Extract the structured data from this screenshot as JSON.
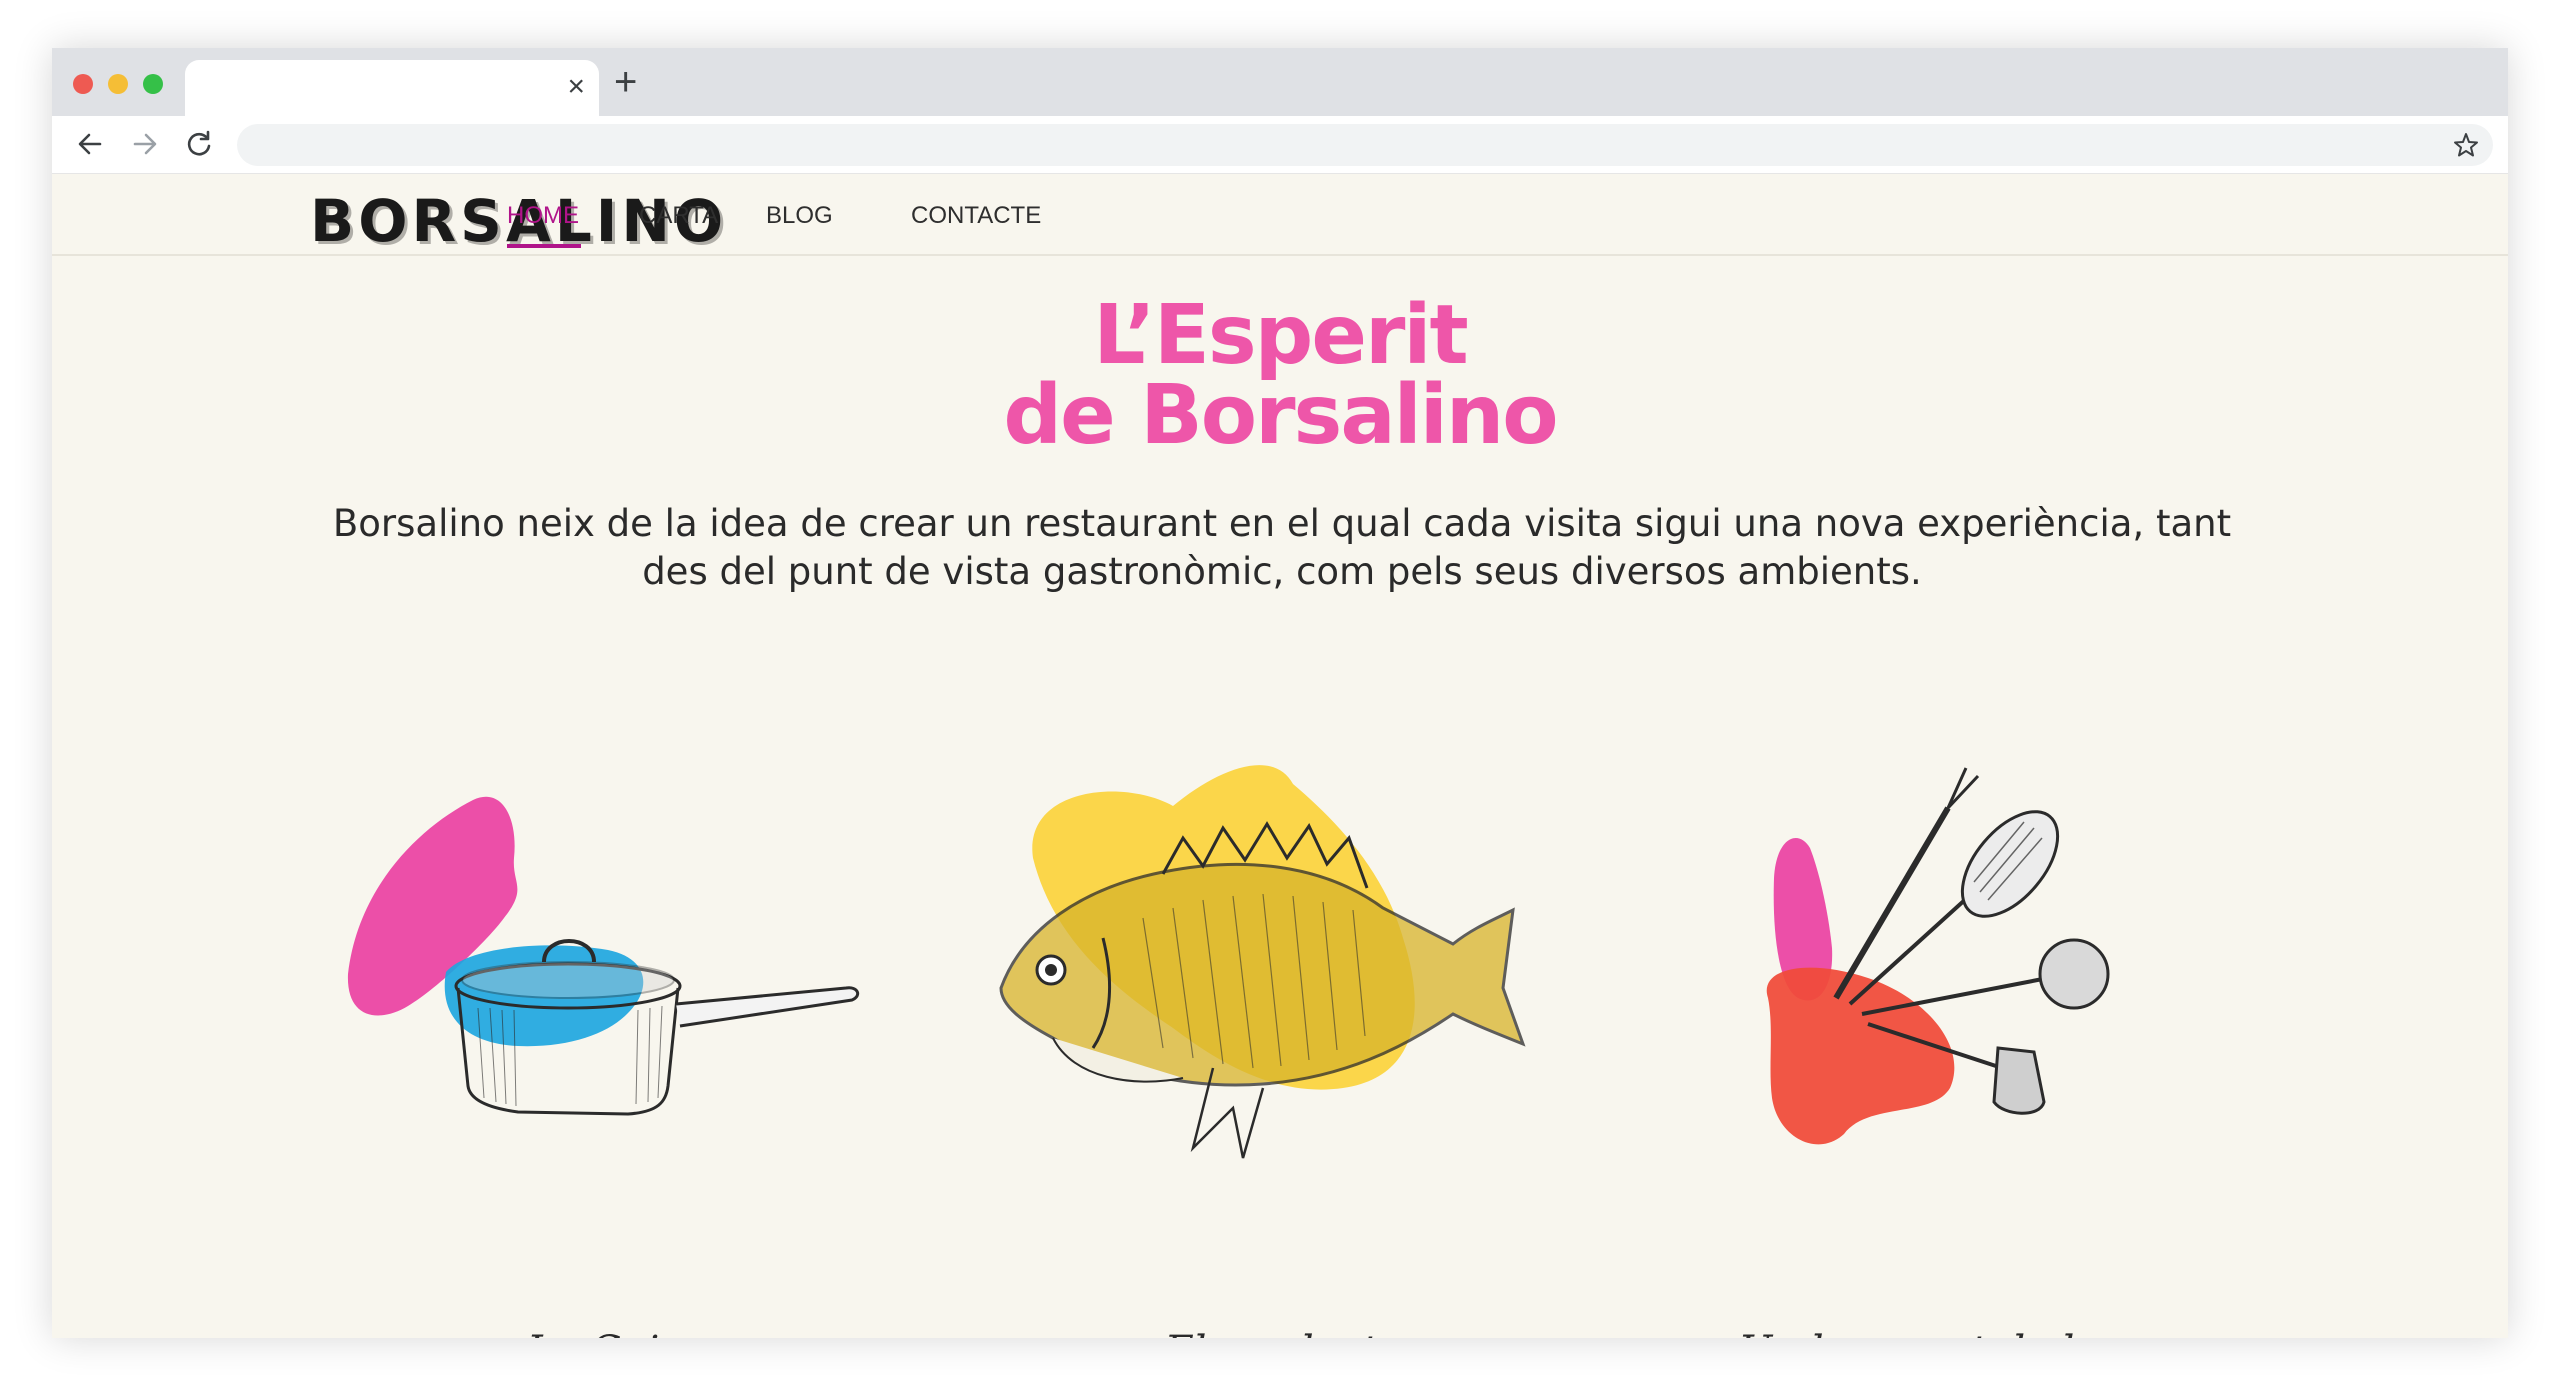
{
  "browser": {
    "tab_close_glyph": "×",
    "new_tab_glyph": "+",
    "icons": [
      "back-arrow-icon",
      "forward-arrow-icon",
      "reload-icon",
      "bookmark-star-icon"
    ]
  },
  "site": {
    "logo": "BORSALINO",
    "nav": [
      "HOME",
      "CARTA",
      "BLOG",
      "CONTACTE"
    ],
    "active_nav": "HOME",
    "accent": "#b0148a"
  },
  "hero": {
    "title_line1": "L’Esperit",
    "title_line2": "de Borsalino",
    "subtitle": "Borsalino neix de la idea de crear un restaurant en el qual cada visita sigui una nova experiència, tant des del punt de vista gastronòmic, com pels seus diversos ambients.",
    "title_color": "#ee56a9"
  },
  "features": [
    {
      "label": "La Cuina",
      "illustration": "cooking-pot-illustration",
      "colors": [
        "#ec4fa8",
        "#1ea6e0"
      ]
    },
    {
      "label": "El producte",
      "illustration": "fish-illustration",
      "colors": [
        "#fbd64a"
      ]
    },
    {
      "label": "Un bon gust de boca",
      "illustration": "kitchen-utensils-illustration",
      "colors": [
        "#ec4fa8",
        "#f04b3a"
      ]
    }
  ]
}
